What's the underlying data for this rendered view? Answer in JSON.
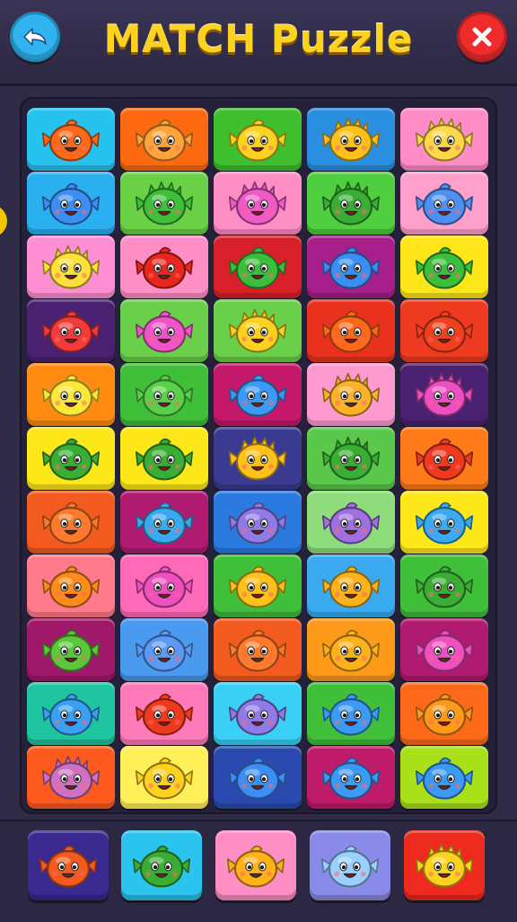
{
  "header": {
    "title": "MATCH Puzzle",
    "title_color": "#ffd21f",
    "back_icon": "back-arrow-icon",
    "close_icon": "close-x-icon",
    "back_color": "#2fb4ef",
    "close_color": "#ef2b2b"
  },
  "board": {
    "rows": [
      [
        {
          "bg": "#25c3ee",
          "face": "#ff6a1a",
          "spiky": false
        },
        {
          "bg": "#ff6a10",
          "face": "#ffa33a",
          "spiky": false
        },
        {
          "bg": "#3fbf2e",
          "face": "#ffd21f",
          "spiky": false
        },
        {
          "bg": "#2a8fe0",
          "face": "#ffc21a",
          "spiky": true
        },
        {
          "bg": "#ff8cc6",
          "face": "#ffd84a",
          "spiky": true
        }
      ],
      [
        {
          "bg": "#2aaff0",
          "face": "#3c8ef5",
          "spiky": false
        },
        {
          "bg": "#6ad046",
          "face": "#3fbf3a",
          "spiky": true
        },
        {
          "bg": "#ff8ec4",
          "face": "#f05ac8",
          "spiky": true
        },
        {
          "bg": "#4fcf3f",
          "face": "#3aae34",
          "spiky": true
        },
        {
          "bg": "#ff9fcb",
          "face": "#4f8ff0",
          "spiky": false
        }
      ],
      [
        {
          "bg": "#ff8fd2",
          "face": "#ffe03a",
          "spiky": true
        },
        {
          "bg": "#ff8fc4",
          "face": "#e8261e",
          "spiky": false
        },
        {
          "bg": "#d9202a",
          "face": "#3abf3a",
          "spiky": false
        },
        {
          "bg": "#a71f8a",
          "face": "#3a8ef5",
          "spiky": false
        },
        {
          "bg": "#ffe61a",
          "face": "#3abf3a",
          "spiky": false
        }
      ],
      [
        {
          "bg": "#4a2170",
          "face": "#f53a3a",
          "spiky": false
        },
        {
          "bg": "#6ad04a",
          "face": "#ee55c8",
          "spiky": false
        },
        {
          "bg": "#6ad04a",
          "face": "#ffd21f",
          "spiky": true
        },
        {
          "bg": "#e8321e",
          "face": "#ff6a1a",
          "spiky": false
        },
        {
          "bg": "#ee3a1e",
          "face": "#f2401e",
          "spiky": false
        }
      ],
      [
        {
          "bg": "#ff8c10",
          "face": "#ffe83a",
          "spiky": false
        },
        {
          "bg": "#3fbf3a",
          "face": "#5ad04a",
          "spiky": false
        },
        {
          "bg": "#c4186a",
          "face": "#3a9af5",
          "spiky": false
        },
        {
          "bg": "#ff9ad0",
          "face": "#ffb22a",
          "spiky": true
        },
        {
          "bg": "#4a2170",
          "face": "#ee4fc0",
          "spiky": true
        }
      ],
      [
        {
          "bg": "#ffe81a",
          "face": "#3aae34",
          "spiky": false
        },
        {
          "bg": "#ffe81a",
          "face": "#3aae34",
          "spiky": false
        },
        {
          "bg": "#3a3a90",
          "face": "#ffc21a",
          "spiky": true
        },
        {
          "bg": "#5ac84a",
          "face": "#3aae34",
          "spiky": true
        },
        {
          "bg": "#ff7a18",
          "face": "#f03a1e",
          "spiky": false
        }
      ],
      [
        {
          "bg": "#f25a1e",
          "face": "#ff7a2a",
          "spiky": false
        },
        {
          "bg": "#b01a70",
          "face": "#3aaaf0",
          "spiky": false
        },
        {
          "bg": "#2a7ae0",
          "face": "#8f7ae8",
          "spiky": false
        },
        {
          "bg": "#8fdc7a",
          "face": "#a070e0",
          "spiky": false
        },
        {
          "bg": "#ffe81a",
          "face": "#3aaaf5",
          "spiky": false
        }
      ],
      [
        {
          "bg": "#ff7a8a",
          "face": "#ff8c1a",
          "spiky": false
        },
        {
          "bg": "#ff6ab8",
          "face": "#ee50c0",
          "spiky": false
        },
        {
          "bg": "#3fbf3a",
          "face": "#ffc21a",
          "spiky": false
        },
        {
          "bg": "#3aaaf0",
          "face": "#ffb21a",
          "spiky": false
        },
        {
          "bg": "#3fbf3a",
          "face": "#3aae34",
          "spiky": false
        }
      ],
      [
        {
          "bg": "#a0186a",
          "face": "#5ac83a",
          "spiky": false
        },
        {
          "bg": "#4a9af0",
          "face": "#5a9af5",
          "spiky": false
        },
        {
          "bg": "#f25a1e",
          "face": "#ff7a2a",
          "spiky": false
        },
        {
          "bg": "#ff9a1a",
          "face": "#ffb21a",
          "spiky": false
        },
        {
          "bg": "#b01a70",
          "face": "#ee50c0",
          "spiky": false
        }
      ],
      [
        {
          "bg": "#1fc4a0",
          "face": "#3aa0f5",
          "spiky": false
        },
        {
          "bg": "#ff7ab8",
          "face": "#f03a1e",
          "spiky": false
        },
        {
          "bg": "#3ad0f5",
          "face": "#8f7ae8",
          "spiky": false
        },
        {
          "bg": "#3fbf3a",
          "face": "#3a9af5",
          "spiky": false
        },
        {
          "bg": "#ff6a1a",
          "face": "#ff9a1a",
          "spiky": false
        }
      ],
      [
        {
          "bg": "#ff5a1e",
          "face": "#d070c0",
          "spiky": true
        },
        {
          "bg": "#fff05a",
          "face": "#ffd21f",
          "spiky": false
        },
        {
          "bg": "#2a4ab0",
          "face": "#3a8ef5",
          "spiky": false
        },
        {
          "bg": "#c01a6a",
          "face": "#3a9af5",
          "spiky": false
        },
        {
          "bg": "#a8e01a",
          "face": "#3a9af5",
          "spiky": false
        }
      ]
    ]
  },
  "tray": {
    "tiles": [
      {
        "bg": "#3a2a90",
        "face": "#f25a1e",
        "spiky": false
      },
      {
        "bg": "#2ac4ee",
        "face": "#3aae34",
        "spiky": false
      },
      {
        "bg": "#ff8ec4",
        "face": "#ffb21a",
        "spiky": false
      },
      {
        "bg": "#8a8ae8",
        "face": "#9ad0ff",
        "spiky": false
      },
      {
        "bg": "#ee2a1e",
        "face": "#ffd21f",
        "spiky": true
      }
    ]
  }
}
